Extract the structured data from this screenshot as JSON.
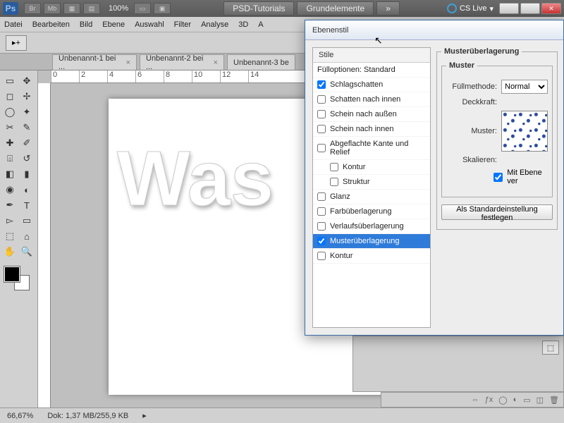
{
  "titlebar": {
    "ps": "Ps",
    "br": "Br",
    "mb": "Mb",
    "zoom": "100%",
    "tabs": [
      "PSD-Tutorials",
      "Grundelemente"
    ],
    "cslive": "CS Live"
  },
  "menu": [
    "Datei",
    "Bearbeiten",
    "Bild",
    "Ebene",
    "Auswahl",
    "Filter",
    "Analyse",
    "3D",
    "A"
  ],
  "doctabs": [
    "Unbenannt-1 bei ...",
    "Unbenannt-2 bei ...",
    "Unbenannt-3 be"
  ],
  "ruler_marks": [
    "0",
    "2",
    "4",
    "6",
    "8",
    "10",
    "12",
    "14"
  ],
  "canvas_text": "Was",
  "status": {
    "zoom": "66,67%",
    "doc": "Dok: 1,37 MB/255,9 KB"
  },
  "dialog": {
    "title": "Ebenenstil",
    "styles_header": "Stile",
    "fill_opts": "Fülloptionen: Standard",
    "items": [
      {
        "label": "Schlagschatten",
        "checked": true
      },
      {
        "label": "Schatten nach innen",
        "checked": false
      },
      {
        "label": "Schein nach außen",
        "checked": false
      },
      {
        "label": "Schein nach innen",
        "checked": false
      },
      {
        "label": "Abgeflachte Kante und Relief",
        "checked": false
      },
      {
        "label": "Kontur",
        "checked": false,
        "sub": true
      },
      {
        "label": "Struktur",
        "checked": false,
        "sub": true
      },
      {
        "label": "Glanz",
        "checked": false
      },
      {
        "label": "Farbüberlagerung",
        "checked": false
      },
      {
        "label": "Verlaufsüberlagerung",
        "checked": false
      },
      {
        "label": "Musterüberlagerung",
        "checked": true,
        "selected": true
      },
      {
        "label": "Kontur",
        "checked": false
      }
    ],
    "group_title": "Musterüberlagerung",
    "sub_group": "Muster",
    "blend_label": "Füllmethode:",
    "blend_value": "Normal",
    "opacity_label": "Deckkraft:",
    "pattern_label": "Muster:",
    "scale_label": "Skalieren:",
    "link_label": "Mit Ebene ver",
    "default_btn": "Als Standardeinstellung festlegen"
  }
}
